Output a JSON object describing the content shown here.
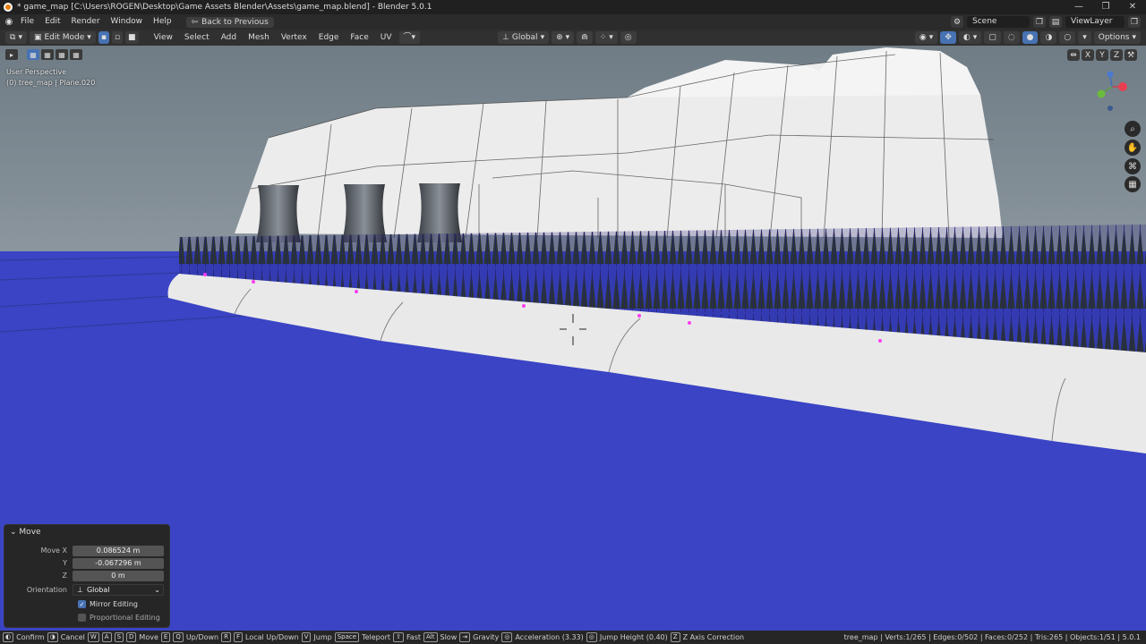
{
  "window": {
    "title": "* game_map [C:\\Users\\ROGEN\\Desktop\\Game Assets Blender\\Assets\\game_map.blend] - Blender 5.0.1",
    "controls": [
      "—",
      "❐",
      "✕"
    ]
  },
  "menubar": {
    "items": [
      "File",
      "Edit",
      "Render",
      "Window",
      "Help"
    ],
    "back_button": "Back to Previous",
    "scene": "Scene",
    "view_layer": "ViewLayer"
  },
  "header3d": {
    "mode": "Edit Mode",
    "menus": [
      "View",
      "Select",
      "Add",
      "Mesh",
      "Vertex",
      "Edge",
      "Face",
      "UV"
    ],
    "orientation": "Global",
    "options": "Options"
  },
  "viewport": {
    "perspective": "User Perspective",
    "object_info": "(0) tree_map | Plane.020",
    "gizmo_axes": [
      "X",
      "Y",
      "Z"
    ],
    "colors": {
      "sky_top": "#6f7c85",
      "sky_bottom": "#8c979f",
      "water": "#3a44c4",
      "wall": "#ececec",
      "trees": "#2f3a1e",
      "wire": "#1b1a6a"
    }
  },
  "move_panel": {
    "title": "Move",
    "move_x_label": "Move X",
    "move_x": "0.086524 m",
    "y_label": "Y",
    "y": "-0.067296 m",
    "z_label": "Z",
    "z": "0 m",
    "orientation_label": "Orientation",
    "orientation": "Global",
    "mirror_editing": "Mirror Editing",
    "mirror_editing_checked": true,
    "proportional_editing": "Proportional Editing",
    "proportional_editing_checked": false
  },
  "statusbar": {
    "items": [
      {
        "keys": [],
        "label": "Confirm"
      },
      {
        "keys": [],
        "label": "Cancel"
      },
      {
        "keys": [
          "W",
          "A",
          "S",
          "D"
        ],
        "label": "Move"
      },
      {
        "keys": [
          "E",
          "Q"
        ],
        "label": "Up/Down"
      },
      {
        "keys": [
          "R",
          "F"
        ],
        "label": "Local Up/Down"
      },
      {
        "keys": [
          "V"
        ],
        "label": "Jump"
      },
      {
        "keys": [
          "Space"
        ],
        "label": "Teleport"
      },
      {
        "keys": [
          "⇧"
        ],
        "label": "Fast"
      },
      {
        "keys": [
          "Alt"
        ],
        "label": "Slow"
      },
      {
        "keys": [],
        "label": "Gravity"
      },
      {
        "keys": [],
        "label": "Acceleration (3.33)"
      },
      {
        "keys": [],
        "label": "Jump Height (0.40)"
      },
      {
        "keys": [
          "Z"
        ],
        "label": "Z Axis Correction"
      }
    ],
    "stats": "tree_map | Verts:1/265 | Edges:0/502 | Faces:0/252 | Tris:265 | Objects:1/51 | 5.0.1"
  }
}
